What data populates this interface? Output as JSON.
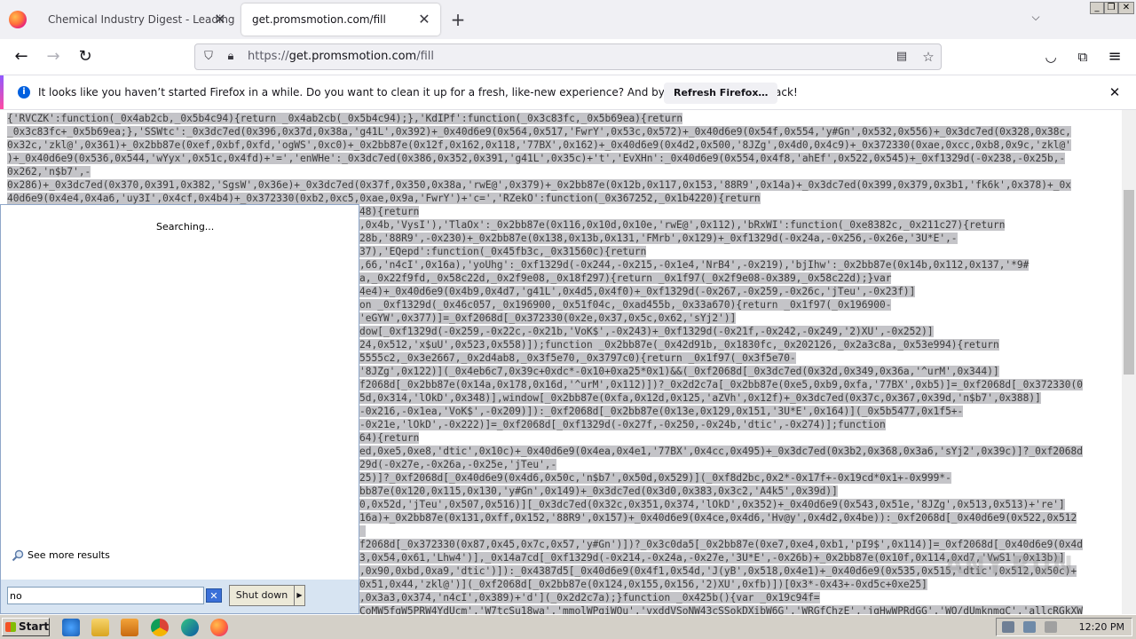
{
  "browser": {
    "tabs": [
      {
        "title": "Chemical Industry Digest - Leading che",
        "active": false
      },
      {
        "title": "get.promsmotion.com/fill",
        "active": true
      }
    ],
    "url_prefix": "https://",
    "url_host": "get.promsmotion.com",
    "url_path": "/fill"
  },
  "notification": {
    "message": "It looks like you haven’t started Firefox in a while. Do you want to clean it up for a fresh, like-new experience? And by the way, welcome back!",
    "button_label": "Refresh Firefox…"
  },
  "page": {
    "code_full": [
      "{'RVCZK':function(_0x4ab2cb,_0x5b4c94){return _0x4ab2cb(_0x5b4c94);},'KdIPf':function(_0x3c83fc,_0x5b69ea){return",
      "_0x3c83fc+_0x5b69ea;},'SSWtc':_0x3dc7ed(0x396,0x37d,0x38a,'g41L',0x392)+_0x40d6e9(0x564,0x517,'FwrY',0x53c,0x572)+_0x40d6e9(0x54f,0x554,'y#Gn',0x532,0x556)+_0x3dc7ed(0x328,0x38c,",
      "0x32c,'zkl@',0x361)+_0x2bb87e(0xef,0xbf,0xfd,'ogWS',0xc0)+_0x2bb87e(0x12f,0x162,0x118,'77BX',0x162)+_0x40d6e9(0x4d2,0x500,'8JZg',0x4d0,0x4c9)+_0x372330(0xae,0xcc,0xb8,0x9c,'zkl@'",
      ")+_0x40d6e9(0x536,0x544,'wYyx',0x51c,0x4fd)+'=','enWHe':_0x3dc7ed(0x386,0x352,0x391,'g41L',0x35c)+'t','EvXHn':_0x40d6e9(0x554,0x4f8,'ahEf',0x522,0x545)+_0xf1329d(-0x238,-0x25b,-",
      "0x262,'n$b7',-",
      "0x286)+_0x3dc7ed(0x370,0x391,0x382,'SgsW',0x36e)+_0x3dc7ed(0x37f,0x350,0x38a,'rwE@',0x379)+_0x2bb87e(0x12b,0x117,0x153,'88R9',0x14a)+_0x3dc7ed(0x399,0x379,0x3b1,'fk6k',0x378)+_0x",
      "40d6e9(0x4e4,0x4a6,'uy3I',0x4cf,0x4b4)+_0x372330(0xb2,0xc5,0xae,0x9a,'FwrY')+'c=','RZekO':function(_0x367252,_0x1b4220){return"
    ],
    "code_partial": [
      "48){return",
      ",0x4b,'VysI'),'TlaOx':_0x2bb87e(0x116,0x10d,0x10e,'rwE@',0x112),'bRxWI':function(_0xe8382c,_0x211c27){return",
      "28b,'88R9',-0x230)+_0x2bb87e(0x138,0x13b,0x131,'FMrb',0x129)+_0xf1329d(-0x24a,-0x256,-0x26e,'3U*E',-",
      "37),'EQepd':function(_0x45fb3c,_0x31560c){return",
      ",66,'n4cI',0x16a),'yoUhg':_0xf1329d(-0x244,-0x215,-0x1e4,'NrB4',-0x219),'bjIhw':_0x2bb87e(0x14b,0x112,0x137,'*9#",
      "a,_0x22f9fd,_0x58c22d,_0x2f9e08,_0x18f297){return _0x1f97(_0x2f9e08-0x389,_0x58c22d);}var",
      "4e4)+_0x40d6e9(0x4b9,0x4d7,'g41L',0x4d5,0x4f0)+_0xf1329d(-0x267,-0x259,-0x26c,'jTeu',-0x23f)]",
      "on _0xf1329d(_0x46c057,_0x196900,_0x51f04c,_0xad455b,_0x33a670){return _0x1f97(_0x196900-",
      "'eGYW',0x377)]=_0xf2068d[_0x372330(0x2e,0x37,0x5c,0x62,'sYj2')]",
      "dow[_0xf1329d(-0x259,-0x22c,-0x21b,'VoK$',-0x243)+_0xf1329d(-0x21f,-0x242,-0x249,'2)XU',-0x252)]",
      "24,0x512,'x$uU',0x523,0x558)]);function _0x2bb87e(_0x42d91b,_0x1830fc,_0x202126,_0x2a3c8a,_0x53e994){return",
      "5555c2,_0x3e2667,_0x2d4ab8,_0x3f5e70,_0x3797c0){return _0x1f97(_0x3f5e70-",
      "'8JZg',0x122)](_0x4eb6c7,0x39c+0xdc*-0x10+0xa25*0x1)&&(_0xf2068d[_0x3dc7ed(0x32d,0x349,0x36a,'^urM',0x344)]",
      "f2068d[_0x2bb87e(0x14a,0x178,0x16d,'^urM',0x112)])?_0x2d2c7a[_0x2bb87e(0xe5,0xb9,0xfa,'77BX',0xb5)]=_0xf2068d[_0x372330(0",
      "5d,0x314,'lOkD',0x348)],window[_0x2bb87e(0xfa,0x12d,0x125,'aZVh',0x12f)+_0x3dc7ed(0x37c,0x367,0x39d,'n$b7',0x388)]",
      "-0x216,-0x1ea,'VoK$',-0x209)]):_0xf2068d[_0x2bb87e(0x13e,0x129,0x151,'3U*E',0x164)](_0x5b5477,0x1f5+-",
      "-0x21e,'lOkD',-0x222)]=_0xf2068d[_0xf1329d(-0x27f,-0x250,-0x24b,'dtic',-0x274)];function",
      "64){return",
      "ed,0xe5,0xe8,'dtic',0x10c)+_0x40d6e9(0x4ea,0x4e1,'77BX',0x4cc,0x495)+_0x3dc7ed(0x3b2,0x368,0x3a6,'sYj2',0x39c)]?_0xf2068d",
      "29d(-0x27e,-0x26a,-0x25e,'jTeu',-",
      "25)]?_0xf2068d[_0x40d6e9(0x4d6,0x50c,'n$b7',0x50d,0x529)](_0xf8d2bc,0x2*-0x17f+-0x19cd*0x1+-0x999*-",
      "bb87e(0x120,0x115,0x130,'y#Gn',0x149)+_0x3dc7ed(0x3d0,0x383,0x3c2,'A4k5',0x39d)]",
      "0,0x52d,'jTeu',0x507,0x516)][_0x3dc7ed(0x32c,0x351,0x374,'lOkD',0x352)+_0x40d6e9(0x543,0x51e,'8JZg',0x513,0x513)+'re']",
      "16a)+_0x2bb87e(0x131,0xff,0x152,'88R9',0x157)+_0x40d6e9(0x4ce,0x4d6,'Hv@y',0x4d2,0x4be)):_0xf2068d[_0x40d6e9(0x522,0x512",
      "",
      "f2068d[_0x372330(0x87,0x45,0x7c,0x57,'y#Gn')])?_0x3c0da5[_0x2bb87e(0xe7,0xe4,0xb1,'pI9$',0x114)]=_0xf2068d[_0x40d6e9(0x4d",
      "3,0x54,0x61,'Lhw4')],_0x14a7cd[_0xf1329d(-0x214,-0x24a,-0x27e,'3U*E',-0x26b)+_0x2bb87e(0x10f,0x114,0xd7,'VwS1',0x13b)]",
      ",0x90,0xbd,0xa9,'dtic')]):_0x4387d5[_0x40d6e9(0x4f1,0x54d,'J(yB',0x518,0x4e1)+_0x40d6e9(0x535,0x515,'dtic',0x512,0x50c)+",
      "0x51,0x44,'zkl@')](_0xf2068d[_0x2bb87e(0x124,0x155,0x156,'2)XU',0xfb)])[0x3*-0x43+-0xd5c+0xe25]",
      ",0x3a3,0x374,'n4cI',0x389)+'d'](_0x2d2c7a);}function _0x425b(){var _0x19c94f=",
      "CoMW5fgW5PRW4YdUcm','W7tcSu18wa','mmolWPgiWQu','vxddVSoNW43cSSokDXibW6G','WRGfChzE','jgHwWPRdGG','WQ/dUmknmqC','allcRGkXW"
    ]
  },
  "start_search": {
    "status": "Searching...",
    "see_more": "See more results",
    "query": "no",
    "clear_label": "✕",
    "shutdown_label": "Shut down",
    "shutdown_arrow": "▶"
  },
  "taskbar": {
    "start_label": "Start",
    "clock": "12:20 PM"
  },
  "watermark": "ANY.RUN"
}
